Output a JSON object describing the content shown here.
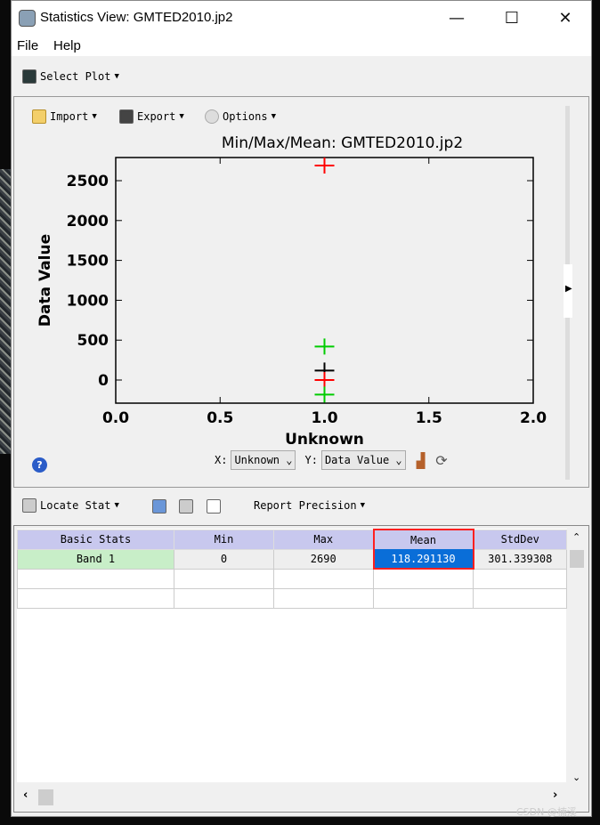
{
  "window": {
    "title": "Statistics View: GMTED2010.jp2",
    "minimize": "—",
    "maximize": "☐",
    "close": "✕"
  },
  "menu": [
    "File",
    "Help"
  ],
  "toolbar": {
    "select_plot": "Select Plot"
  },
  "plot_toolbar": {
    "import": "Import",
    "export": "Export",
    "options": "Options"
  },
  "plot_controls": {
    "x_label": "X:",
    "x_value": "Unknown",
    "y_label": "Y:",
    "y_value": "Data Value"
  },
  "stats_toolbar": {
    "locate_stat": "Locate Stat",
    "report_precision": "Report Precision"
  },
  "table": {
    "headers": [
      "Basic Stats",
      "Min",
      "Max",
      "Mean",
      "StdDev"
    ],
    "rows": [
      [
        "Band 1",
        "0",
        "2690",
        "118.291130",
        "301.339308"
      ]
    ],
    "selected_cell": "Mean",
    "highlight_color": "#ff2020"
  },
  "watermark": "CSDN @楠溪",
  "chart_data": {
    "type": "scatter",
    "title": "Min/Max/Mean: GMTED2010.jp2",
    "xlabel": "Unknown",
    "ylabel": "Data Value",
    "xlim": [
      0,
      2
    ],
    "ylim": [
      -290,
      2790
    ],
    "xticks": [
      "0.0",
      "0.5",
      "1.0",
      "1.5",
      "2.0"
    ],
    "yticks": [
      "0",
      "500",
      "1000",
      "1500",
      "2000",
      "2500"
    ],
    "marker": "plus",
    "points": [
      {
        "x": 1,
        "y": 2690,
        "color": "#ff0000"
      },
      {
        "x": 1,
        "y": 419.6,
        "color": "#00cc00"
      },
      {
        "x": 1,
        "y": 118.3,
        "color": "#000000"
      },
      {
        "x": 1,
        "y": 0,
        "color": "#ff0000"
      },
      {
        "x": 1,
        "y": -183.0,
        "color": "#00cc00"
      }
    ]
  }
}
